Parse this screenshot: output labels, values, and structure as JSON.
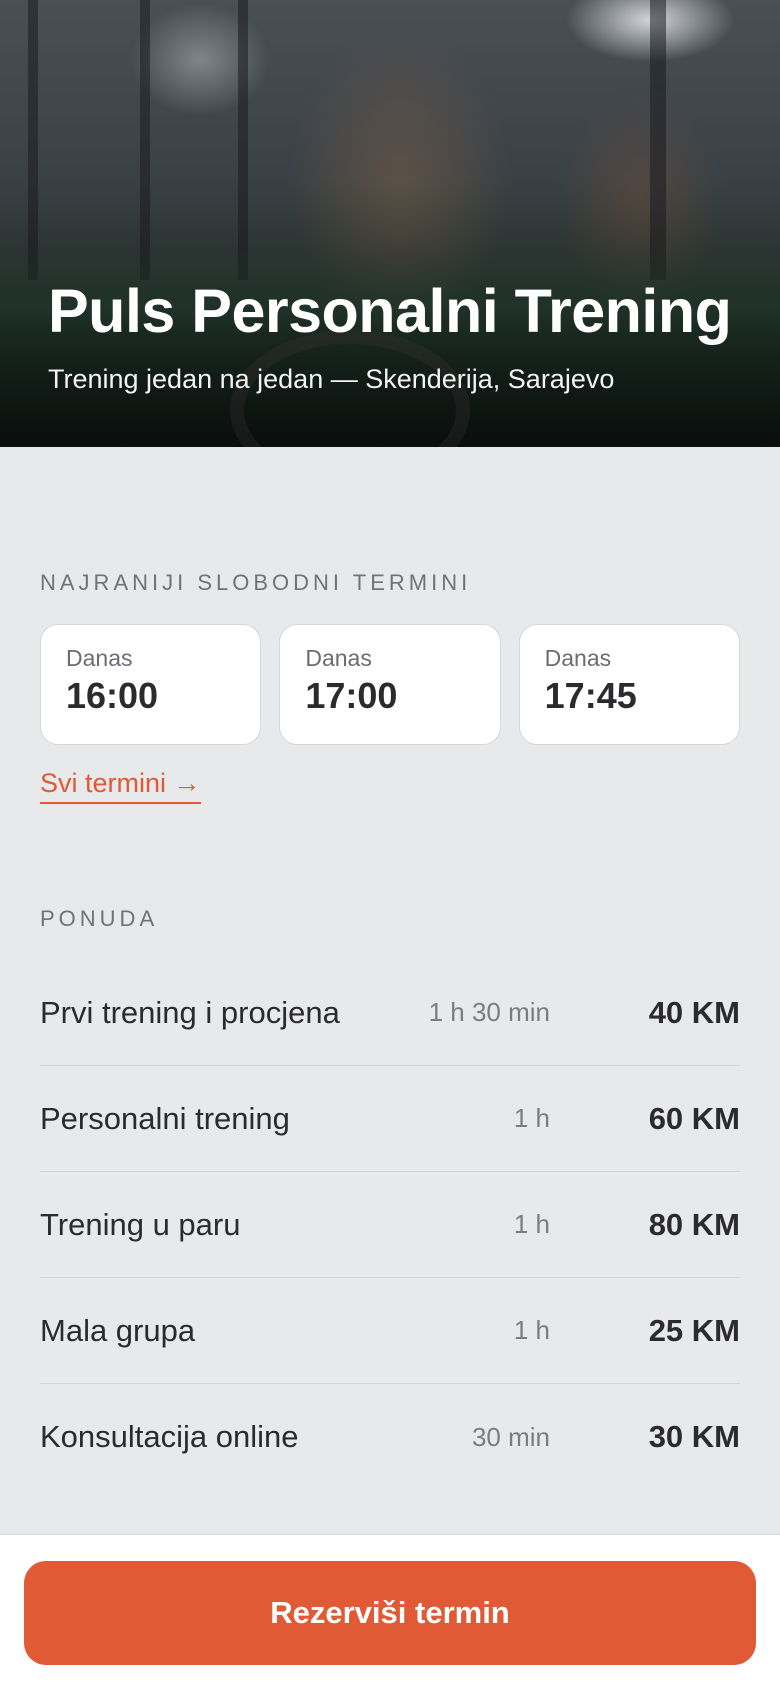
{
  "hero": {
    "title": "Puls Personalni Trening",
    "subtitle": "Trening jedan na jedan — Skenderija, Sarajevo"
  },
  "slots_section": {
    "label": "NAJRANIJI SLOBODNI TERMINI",
    "slots": [
      {
        "day": "Danas",
        "time": "16:00"
      },
      {
        "day": "Danas",
        "time": "17:00"
      },
      {
        "day": "Danas",
        "time": "17:45"
      }
    ],
    "all_link": "Svi termini →"
  },
  "offers_section": {
    "label": "PONUDA",
    "items": [
      {
        "name": "Prvi trening i procjena",
        "duration": "1 h 30 min",
        "price": "40 KM"
      },
      {
        "name": "Personalni trening",
        "duration": "1 h",
        "price": "60 KM"
      },
      {
        "name": "Trening u paru",
        "duration": "1 h",
        "price": "80 KM"
      },
      {
        "name": "Mala grupa",
        "duration": "1 h",
        "price": "25 KM"
      },
      {
        "name": "Konsultacija online",
        "duration": "30 min",
        "price": "30 KM"
      }
    ]
  },
  "cta": {
    "label": "Rezerviši termin"
  },
  "colors": {
    "accent": "#e05a35",
    "background": "#e8e9eb"
  }
}
